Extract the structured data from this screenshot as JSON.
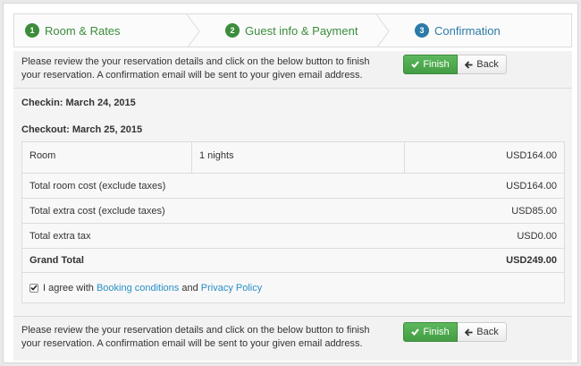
{
  "steps": [
    {
      "num": "1",
      "label": "Room & Rates"
    },
    {
      "num": "2",
      "label": "Guest info & Payment"
    },
    {
      "num": "3",
      "label": "Confirmation"
    }
  ],
  "colors": {
    "step_done": "#3c8c3c",
    "step_active": "#2c7aa8",
    "finish_btn": "#5cb85c",
    "link": "#2a8fc8"
  },
  "notice": {
    "text_line1": "Please review the your reservation details and click on the below button to finish",
    "text_line2": "your reservation. A confirmation email will be sent to your given email address.",
    "finish_label": "Finish",
    "back_label": "Back"
  },
  "reservation": {
    "checkin": "Checkin: March 24, 2015",
    "checkout": "Checkout: March 25, 2015"
  },
  "table": {
    "room_label": "Room",
    "room_nights": "1 nights",
    "room_price": "USD164.00",
    "rows": [
      {
        "label": "Total room cost (exclude taxes)",
        "value": "USD164.00"
      },
      {
        "label": "Total extra cost (exclude taxes)",
        "value": "USD85.00"
      },
      {
        "label": "Total extra tax",
        "value": "USD0.00"
      }
    ],
    "grand_total_label": "Grand Total",
    "grand_total_value": "USD249.00"
  },
  "agreement": {
    "prefix": "I agree with",
    "link1": "Booking conditions",
    "conj": "and",
    "link2": "Privacy Policy",
    "checked": true
  },
  "icons": {
    "finish": "check-icon",
    "back": "arrow-left-icon"
  }
}
